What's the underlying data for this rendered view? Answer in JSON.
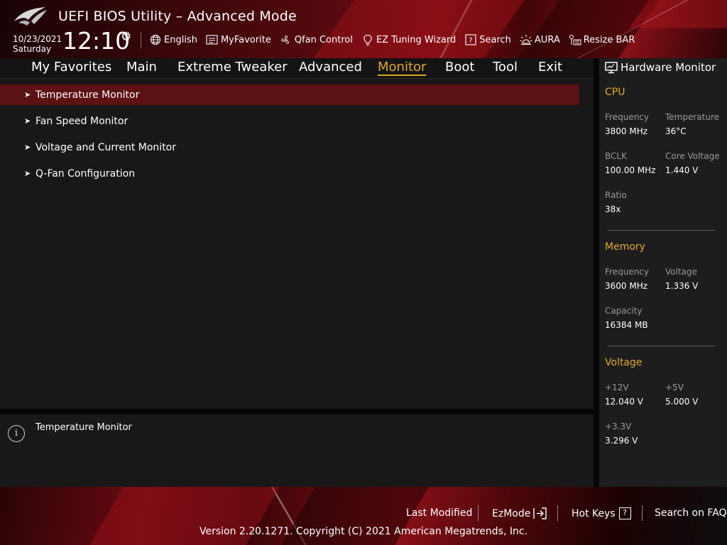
{
  "app": {
    "title": "UEFI BIOS Utility – Advanced Mode",
    "date": "10/23/2021",
    "day": "Saturday",
    "time": "12:10"
  },
  "toolbar": [
    {
      "label": "English",
      "icon": "globe-icon"
    },
    {
      "label": "MyFavorite",
      "icon": "favorite-list-icon"
    },
    {
      "label": "Qfan Control",
      "icon": "fan-icon"
    },
    {
      "label": "EZ Tuning Wizard",
      "icon": "lightbulb-icon"
    },
    {
      "label": "Search",
      "icon": "question-box-icon"
    },
    {
      "label": "AURA",
      "icon": "aura-light-icon"
    },
    {
      "label": "Resize BAR",
      "icon": "resize-bar-icon"
    }
  ],
  "nav": {
    "tabs": [
      "My Favorites",
      "Main",
      "Extreme Tweaker",
      "Advanced",
      "Monitor",
      "Boot",
      "Tool",
      "Exit"
    ],
    "active": "Monitor"
  },
  "menu": {
    "items": [
      "Temperature Monitor",
      "Fan Speed Monitor",
      "Voltage and Current Monitor",
      "Q-Fan Configuration"
    ],
    "selected": "Temperature Monitor"
  },
  "help": {
    "text": "Temperature Monitor"
  },
  "hardware_monitor": {
    "title": "Hardware Monitor",
    "cpu": {
      "heading": "CPU",
      "frequency_label": "Frequency",
      "frequency": "3800 MHz",
      "temperature_label": "Temperature",
      "temperature": "36°C",
      "bclk_label": "BCLK",
      "bclk": "100.00 MHz",
      "core_voltage_label": "Core Voltage",
      "core_voltage": "1.440 V",
      "ratio_label": "Ratio",
      "ratio": "38x"
    },
    "memory": {
      "heading": "Memory",
      "frequency_label": "Frequency",
      "frequency": "3600 MHz",
      "voltage_label": "Voltage",
      "voltage": "1.336 V",
      "capacity_label": "Capacity",
      "capacity": "16384 MB"
    },
    "voltage": {
      "heading": "Voltage",
      "v12_label": "+12V",
      "v12": "12.040 V",
      "v5_label": "+5V",
      "v5": "5.000 V",
      "v33_label": "+3.3V",
      "v33": "3.296 V"
    }
  },
  "footer": {
    "last_modified": "Last Modified",
    "ezmode": "EzMode",
    "hot_keys": "Hot Keys",
    "hot_keys_key": "?",
    "search_faq": "Search on FAQ",
    "version": "Version 2.20.1271. Copyright (C) 2021 American Megatrends, Inc."
  },
  "colors": {
    "accent": "#e0a82c",
    "selected_row": "#5c1113"
  }
}
